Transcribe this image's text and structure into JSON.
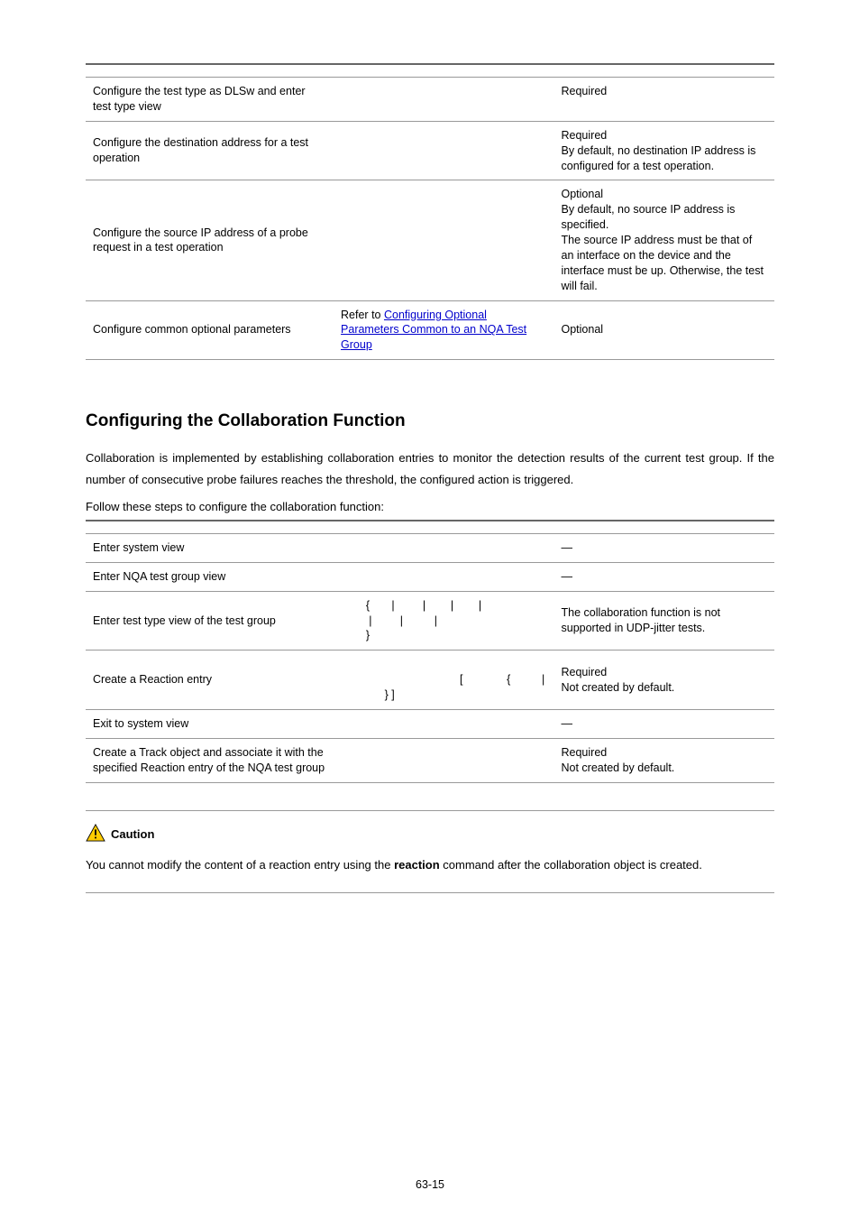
{
  "table1": {
    "rows": [
      {
        "c1": "Configure the test type as DLSw and enter test type view",
        "c2": "",
        "c3": "Required"
      },
      {
        "c1": "Configure the destination address for a test operation",
        "c2": "",
        "c3": "Required\nBy default, no destination IP address is configured for a test operation."
      },
      {
        "c1": "Configure the source IP address of a probe request in a test operation",
        "c2": "",
        "c3": "Optional\nBy default, no source IP address is specified.\nThe source IP address must be that of an interface on the device and the interface must be up. Otherwise, the test will fail."
      },
      {
        "c1": "Configure common optional parameters",
        "c2_prefix": "Refer to ",
        "c2_link": "Configuring Optional Parameters Common to an NQA Test Group",
        "c3": "Optional"
      }
    ]
  },
  "section_heading": "Configuring the Collaboration Function",
  "para1": "Collaboration is implemented by establishing collaboration entries to monitor the detection results of the current test group. If the number of consecutive probe failures reaches the threshold, the configured action is triggered.",
  "para2": "Follow these steps to configure the collaboration function:",
  "table2": {
    "rows": [
      {
        "c1": "Enter system view",
        "c2": "",
        "c3": "—"
      },
      {
        "c1": "Enter NQA test group view",
        "c2": "",
        "c3": "—"
      },
      {
        "c1": "Enter test type view of the test group",
        "c2": "        {       |         |        |        |\n         |         |          |\n        }",
        "c3": "The collaboration function is not supported in UDP-jitter tests."
      },
      {
        "c1": "Create a Reaction entry",
        "c2": "\n                                      [              {          |\n              } ]",
        "c3": "Required\nNot created by default."
      },
      {
        "c1": "Exit to system view",
        "c2": "",
        "c3": "—"
      },
      {
        "c1": "Create a Track object and associate it with the specified Reaction entry of the NQA test group",
        "c2": "",
        "c3": "Required\nNot created by default."
      }
    ]
  },
  "caution": {
    "label": "Caution",
    "text_pre": "You cannot modify the content of a reaction entry using the ",
    "text_bold": "reaction",
    "text_post": " command after the collaboration object is created."
  },
  "page_number": "63-15"
}
